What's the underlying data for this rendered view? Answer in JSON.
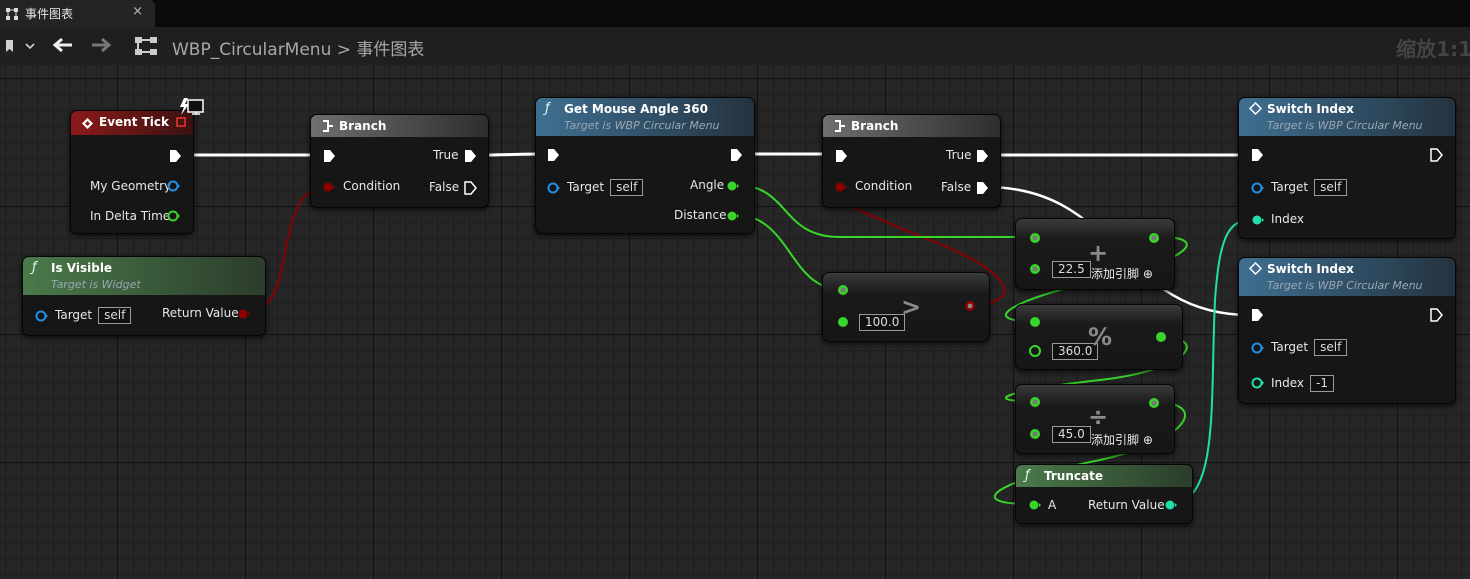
{
  "tab": {
    "label": "事件图表",
    "close": "×"
  },
  "toolbar": {
    "breadcrumb_root": "WBP_CircularMenu",
    "separator": ">",
    "breadcrumb_current": "事件图表",
    "zoom": "缩放1:1"
  },
  "nodes": {
    "event_tick": {
      "title": "Event Tick",
      "pins": [
        "My Geometry",
        "In Delta Time"
      ]
    },
    "is_visible": {
      "title": "Is Visible",
      "subtitle": "Target is Widget",
      "target": "Target",
      "target_val": "self",
      "ret": "Return Value"
    },
    "branch1": {
      "title": "Branch",
      "cond": "Condition",
      "t": "True",
      "f": "False"
    },
    "get_mouse_angle": {
      "title": "Get Mouse Angle 360",
      "subtitle": "Target is WBP Circular Menu",
      "target": "Target",
      "target_val": "self",
      "angle": "Angle",
      "distance": "Distance"
    },
    "branch2": {
      "title": "Branch",
      "cond": "Condition",
      "t": "True",
      "f": "False"
    },
    "greater": {
      "op": ">",
      "val": "100.0"
    },
    "add": {
      "op": "+",
      "val": "22.5",
      "add_pin": "添加引脚"
    },
    "mod": {
      "op": "%",
      "val": "360.0"
    },
    "div": {
      "op": "÷",
      "val": "45.0",
      "add_pin": "添加引脚"
    },
    "truncate": {
      "title": "Truncate",
      "a": "A",
      "ret": "Return Value"
    },
    "switch1": {
      "title": "Switch Index",
      "subtitle": "Target is WBP Circular Menu",
      "target": "Target",
      "target_val": "self",
      "index": "Index"
    },
    "switch2": {
      "title": "Switch Index",
      "subtitle": "Target is WBP Circular Menu",
      "target": "Target",
      "target_val": "self",
      "index": "Index",
      "index_val": "-1"
    }
  },
  "colors": {
    "exec": "#ffffff",
    "bool": "#8c0000",
    "float": "#38d52b",
    "int": "#1fe0aa",
    "object": "#1f8fe3",
    "event_header": "#8c1a1a",
    "func_header_blue": "#3f6f92",
    "func_header_green": "#4b7a4b"
  }
}
